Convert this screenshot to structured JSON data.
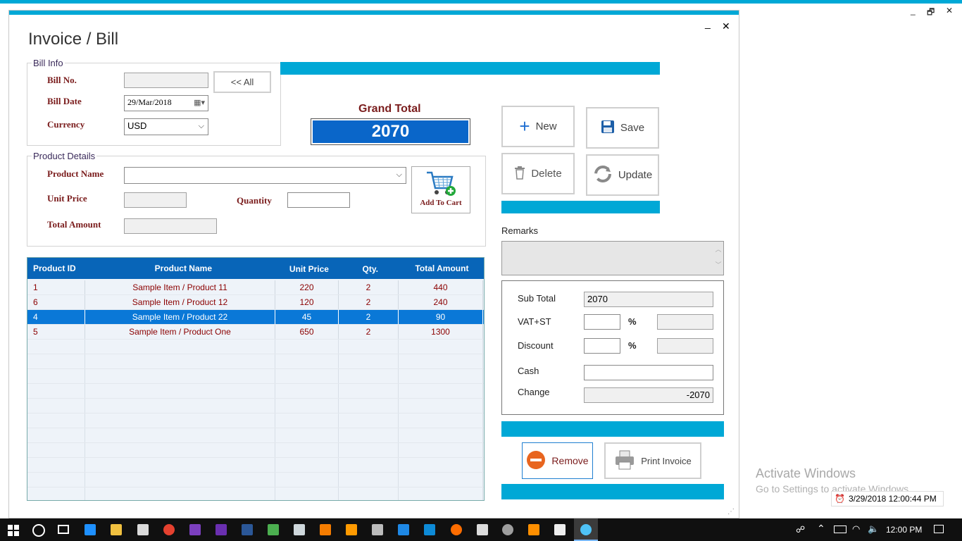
{
  "bg_window": {
    "minimize": "_",
    "restore": "🗗",
    "close": "✕"
  },
  "window": {
    "title": "Invoice / Bill",
    "minimize": "_",
    "close": "✕"
  },
  "bill_info": {
    "legend": "Bill Info",
    "bill_no_label": "Bill No.",
    "bill_no_value": "",
    "all_button": "<< All",
    "bill_date_label": "Bill Date",
    "bill_date_value": "29/Mar/2018",
    "currency_label": "Currency",
    "currency_value": "USD"
  },
  "grand_total": {
    "label": "Grand Total",
    "value": "2070"
  },
  "actions": {
    "new": "New",
    "save": "Save",
    "delete": "Delete",
    "update": "Update"
  },
  "product_details": {
    "legend": "Product Details",
    "product_name_label": "Product Name",
    "product_name_value": "",
    "unit_price_label": "Unit Price",
    "unit_price_value": "",
    "quantity_label": "Quantity",
    "quantity_value": "",
    "total_amount_label": "Total Amount",
    "total_amount_value": "",
    "add_to_cart": "Add To Cart"
  },
  "grid": {
    "columns": [
      "Product ID",
      "Product Name",
      "Unit Price",
      "Qty.",
      "Total Amount"
    ],
    "rows": [
      {
        "id": "1",
        "name": "Sample Item / Product 11",
        "price": "220",
        "qty": "2",
        "total": "440"
      },
      {
        "id": "6",
        "name": "Sample Item / Product 12",
        "price": "120",
        "qty": "2",
        "total": "240"
      },
      {
        "id": "4",
        "name": "Sample Item / Product 22",
        "price": "45",
        "qty": "2",
        "total": "90"
      },
      {
        "id": "5",
        "name": "Sample Item / Product One",
        "price": "650",
        "qty": "2",
        "total": "1300"
      }
    ],
    "selected_index": 2
  },
  "remarks": {
    "label": "Remarks",
    "value": ""
  },
  "summary": {
    "sub_total_label": "Sub Total",
    "sub_total_value": "2070",
    "vat_label": "VAT+ST",
    "vat_percent": "",
    "vat_amount": "",
    "discount_label": "Discount",
    "discount_percent": "",
    "discount_amount": "",
    "percent_sign": "%",
    "cash_label": "Cash",
    "cash_value": "",
    "change_label": "Change",
    "change_value": "-2070"
  },
  "bottom_buttons": {
    "remove": "Remove",
    "print": "Print Invoice"
  },
  "watermark": {
    "line1": "Activate Windows",
    "line2": "Go to Settings to activate Windows."
  },
  "status_clock": "3/29/2018 12:00:44 PM",
  "taskbar": {
    "time": "12:00 PM"
  },
  "colors": {
    "accent_cyan": "#00a8d6",
    "grid_header": "#0865b8",
    "selected_row": "#0a78d7",
    "grand_total_bg": "#0a66c9",
    "label_maroon": "#7a1c1c"
  }
}
